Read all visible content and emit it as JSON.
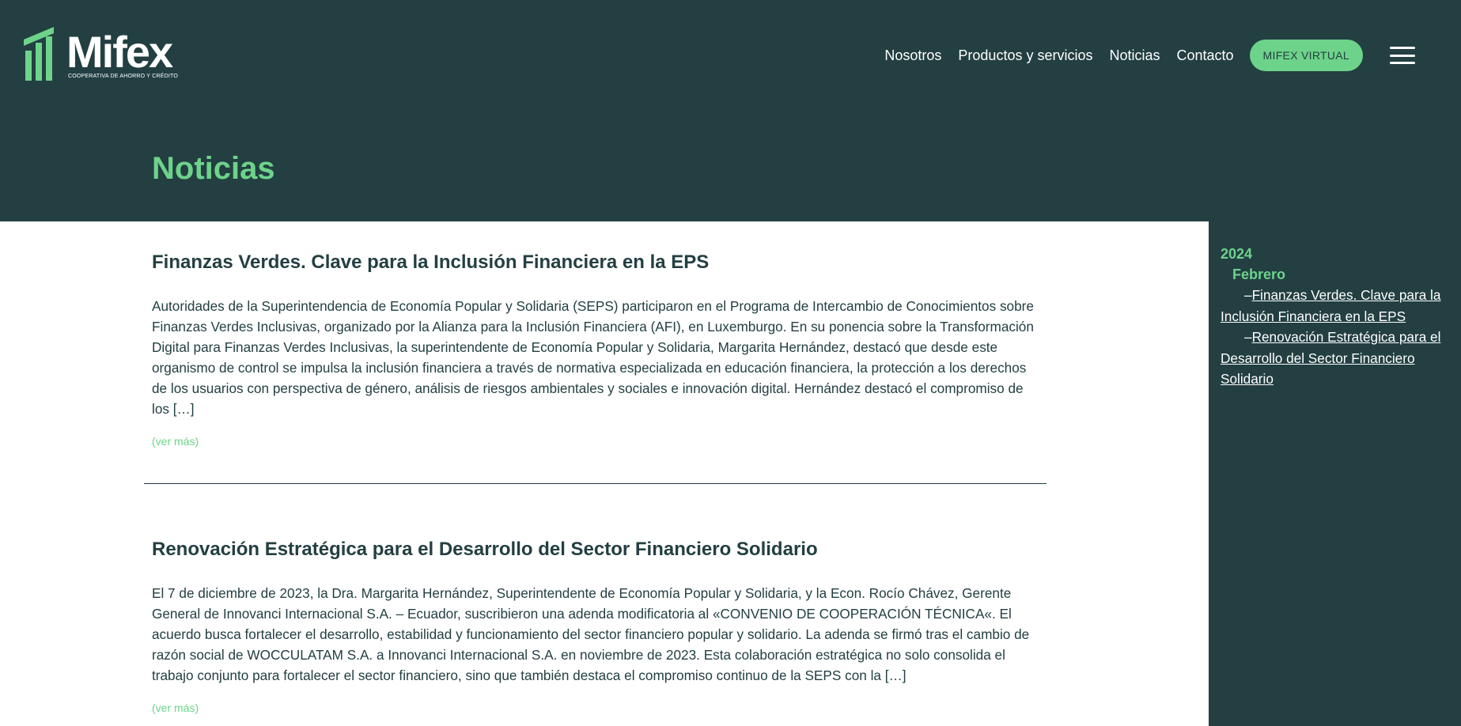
{
  "brand": {
    "name": "Mifex",
    "tagline": "COOPERATIVA DE AHORRO Y CRÉDITO",
    "colors": {
      "dark": "#233f42",
      "accent": "#6dd38a",
      "text": "#233f42"
    }
  },
  "nav": {
    "items": [
      {
        "label": "Nosotros"
      },
      {
        "label": "Productos y servicios"
      },
      {
        "label": "Noticias"
      },
      {
        "label": "Contacto"
      }
    ],
    "cta_label": "MIFEX VIRTUAL",
    "menu_icon": "hamburger-menu-icon"
  },
  "page": {
    "title": "Noticias"
  },
  "posts": [
    {
      "title": "Finanzas Verdes. Clave para la Inclusión Financiera en la EPS",
      "excerpt": "Autoridades de la Superintendencia de Economía Popular y Solidaria (SEPS) participaron en el Programa de Intercambio de Conocimientos sobre Finanzas Verdes Inclusivas, organizado por la Alianza para la Inclusión Financiera (AFI), en Luxemburgo. En su ponencia sobre la Transformación Digital para Finanzas Verdes Inclusivas, la superintendente de Economía Popular y Solidaria, Margarita Hernández, destacó que desde este organismo de control se impulsa la inclusión financiera a través de normativa especializada en educación financiera, la protección a los derechos de los usuarios con perspectiva de género, análisis de riesgos ambientales y sociales e innovación digital. Hernández destacó el compromiso de los […]",
      "read_more": "(ver más)"
    },
    {
      "title": "Renovación Estratégica para el Desarrollo del Sector Financiero Solidario",
      "excerpt": "El 7 de diciembre de 2023, la Dra. Margarita Hernández, Superintendente de Economía Popular y Solidaria, y la Econ. Rocío Chávez, Gerente General de Innovanci Internacional S.A. – Ecuador, suscribieron una adenda modificatoria al «CONVENIO DE COOPERACIÓN TÉCNICA«. El acuerdo busca fortalecer el desarrollo, estabilidad y funcionamiento del sector financiero popular y solidario. La adenda se firmó tras el cambio de razón social de WOCCULATAM S.A. a Innovanci Internacional S.A. en noviembre de 2023. Esta colaboración estratégica no solo consolida el trabajo conjunto para fortalecer el sector financiero, sino que también destaca el compromiso continuo de la SEPS con la […]",
      "read_more": "(ver más)"
    }
  ],
  "sidebar": {
    "year": "2024",
    "month": "Febrero",
    "dash": "–",
    "links": [
      {
        "label": "Finanzas Verdes. Clave para la Inclusión Financiera en la EPS"
      },
      {
        "label": "Renovación Estratégica para el Desarrollo del Sector Financiero Solidario"
      }
    ]
  }
}
